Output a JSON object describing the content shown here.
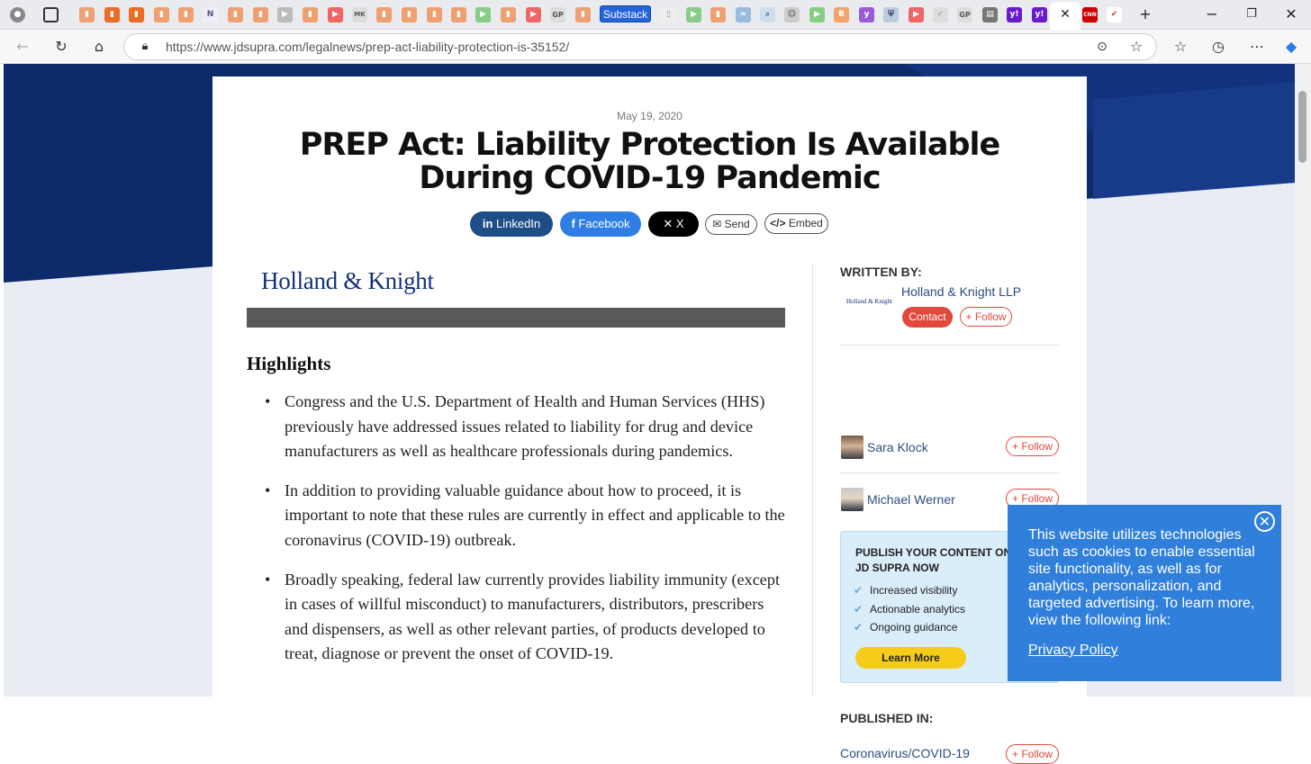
{
  "browser": {
    "url": "https://www.jdsupra.com/legalnews/prep-act-liability-protection-is-35152/",
    "substack_tab": "Substack",
    "favicon_texts": [
      "N",
      "MK",
      "GP",
      "GP",
      "y!",
      "y!",
      "CNN"
    ]
  },
  "article": {
    "date": "May 19, 2020",
    "title": "PREP Act: Liability Protection Is Available During COVID-19 Pandemic",
    "share": {
      "linkedin": "LinkedIn",
      "facebook": "Facebook",
      "x": "X",
      "send": "Send",
      "embed": "Embed"
    },
    "logo_text": "Holland & Knight",
    "highlights_heading": "Highlights",
    "bullets": [
      "Congress and the U.S. Department of Health and Human Services (HHS) previously have addressed issues related to liability for drug and device manufacturers as well as healthcare professionals during pandemics.",
      "In addition to providing valuable guidance about how to proceed, it is important to note that these rules are currently in effect and applicable to the coronavirus (COVID-19) outbreak.",
      "Broadly speaking, federal law currently provides liability immunity (except in cases of willful misconduct) to manufacturers, distributors, prescribers and dispensers, as well as other relevant parties, of products developed to treat, diagnose or prevent the onset of COVID-19."
    ]
  },
  "sidebar": {
    "written_by": "WRITTEN BY:",
    "firm": {
      "logo_text": "Holland & Knight",
      "name": "Holland & Knight LLP",
      "contact": "Contact",
      "follow": "+ Follow"
    },
    "authors": [
      {
        "name": "Sara Klock",
        "follow": "+ Follow"
      },
      {
        "name": "Michael Werner",
        "follow": "+ Follow"
      }
    ],
    "publish": {
      "heading_line1": "PUBLISH YOUR CONTENT ON",
      "heading_line2": "JD SUPRA NOW",
      "items": [
        "Increased visibility",
        "Actionable analytics",
        "Ongoing guidance"
      ],
      "button": "Learn More"
    },
    "published_in": "PUBLISHED IN:",
    "topic": "Coronavirus/COVID-19",
    "topic_follow": "+ Follow"
  },
  "cookie": {
    "text": "This website utilizes technologies such as cookies to enable essential site functionality, as well as for analytics, personalization, and targeted advertising. To learn more, view the following link:",
    "link": "Privacy Policy"
  },
  "colors": {
    "navy": "#0d2a6b",
    "linkedin": "#1d4f86",
    "facebook": "#2f7ee3",
    "follow_red": "#e0483d",
    "cookie_blue": "#2f7fdb",
    "learn_yellow": "#f5cc1a"
  },
  "icons": {
    "back": "back-arrow-icon",
    "refresh": "refresh-icon",
    "home": "home-icon",
    "lock": "lock-icon",
    "star": "star-icon",
    "close": "close-icon"
  }
}
